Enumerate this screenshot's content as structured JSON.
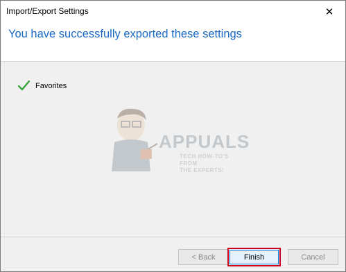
{
  "window": {
    "title": "Import/Export Settings",
    "close_glyph": "✕"
  },
  "header": {
    "heading": "You have successfully exported these settings"
  },
  "results": [
    {
      "label": "Favorites",
      "icon": "checkmark-icon",
      "status": "success"
    }
  ],
  "watermark": {
    "brand": "APPUALS",
    "tagline_line1": "TECH HOW-TO'S FROM",
    "tagline_line2": "THE EXPERTS!"
  },
  "buttons": {
    "back_label": "< Back",
    "finish_label": "Finish",
    "cancel_label": "Cancel"
  },
  "colors": {
    "heading": "#1a6ac4",
    "check": "#3aa33a",
    "finish_highlight": "#d1001b"
  }
}
